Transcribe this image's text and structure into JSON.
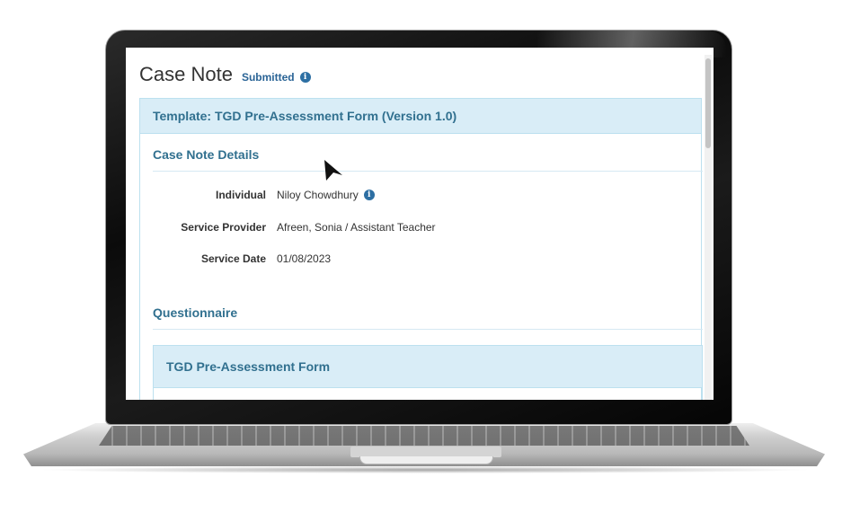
{
  "header": {
    "title": "Case Note",
    "status": "Submitted"
  },
  "template": {
    "label": "Template: TGD Pre-Assessment Form (Version 1.0)"
  },
  "details": {
    "section_title": "Case Note Details",
    "rows": [
      {
        "label": "Individual",
        "value": "Niloy Chowdhury"
      },
      {
        "label": "Service Provider",
        "value": "Afreen, Sonia / Assistant Teacher"
      },
      {
        "label": "Service Date",
        "value": "01/08/2023"
      }
    ]
  },
  "questionnaire": {
    "section_title": "Questionnaire",
    "form_title": "TGD Pre-Assessment Form"
  },
  "icons": {
    "status_info": "info-icon",
    "individual_info": "info-icon",
    "cursor": "mouse-pointer-icon"
  },
  "colors": {
    "accent_text": "#31708f",
    "panel_background": "#d9edf7",
    "panel_border": "#bce0ef",
    "info_icon": "#2d6fa3"
  }
}
